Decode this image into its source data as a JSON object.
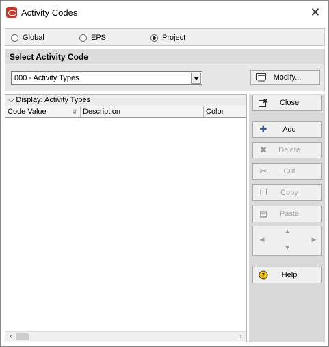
{
  "window": {
    "title": "Activity Codes"
  },
  "scope": {
    "options": [
      {
        "label": "Global",
        "selected": false
      },
      {
        "label": "EPS",
        "selected": false
      },
      {
        "label": "Project",
        "selected": true
      }
    ]
  },
  "section": {
    "title": "Select Activity Code",
    "code_select_value": "000 - Activity Types",
    "modify_label": "Modify..."
  },
  "list": {
    "group_label": "Display: Activity Types",
    "columns": [
      "Code Value",
      "Description",
      "Color"
    ],
    "rows": []
  },
  "actions": {
    "close": "Close",
    "add": "Add",
    "delete": "Delete",
    "cut": "Cut",
    "copy": "Copy",
    "paste": "Paste",
    "help": "Help"
  },
  "colors": {
    "accent": "#c0392b",
    "panel": "#d9d9d9",
    "disabled_text": "#a8a8a8"
  }
}
